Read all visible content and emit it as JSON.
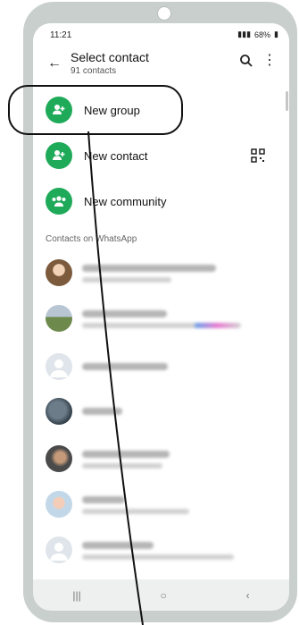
{
  "status": {
    "time": "11:21",
    "battery": "68%"
  },
  "header": {
    "title": "Select contact",
    "subtitle": "91 contacts"
  },
  "actions": [
    {
      "label": "New group",
      "icon": "add-group-icon"
    },
    {
      "label": "New contact",
      "icon": "add-contact-icon"
    },
    {
      "label": "New community",
      "icon": "community-icon"
    }
  ],
  "section_title": "Contacts on WhatsApp",
  "colors": {
    "accent": "#1faa59"
  }
}
